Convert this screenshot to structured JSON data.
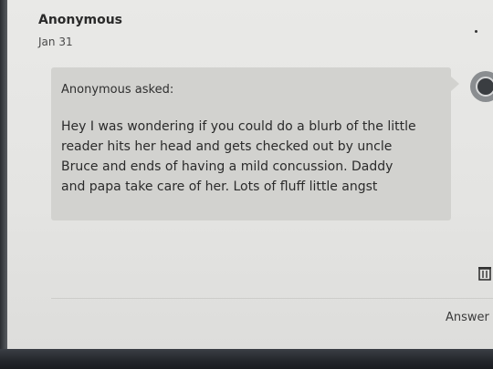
{
  "post": {
    "author": "Anonymous",
    "date": "Jan 31"
  },
  "ask": {
    "asker_label": "Anonymous asked:",
    "question_lines": [
      "Hey I was wondering if you could do a blurb of the little",
      "reader hits her head and gets checked out by uncle",
      "Bruce and ends of having a mild concussion. Daddy",
      "and papa take care of her. Lots of fluff little angst"
    ]
  },
  "actions": {
    "answer_label": "Answer",
    "delete_icon": "trash-icon"
  },
  "icons": {
    "avatar": "avatar-icon",
    "more": "more-dot-icon"
  },
  "colors": {
    "card_background": "#d2d2cf",
    "page_background": "#e6e6e4"
  }
}
